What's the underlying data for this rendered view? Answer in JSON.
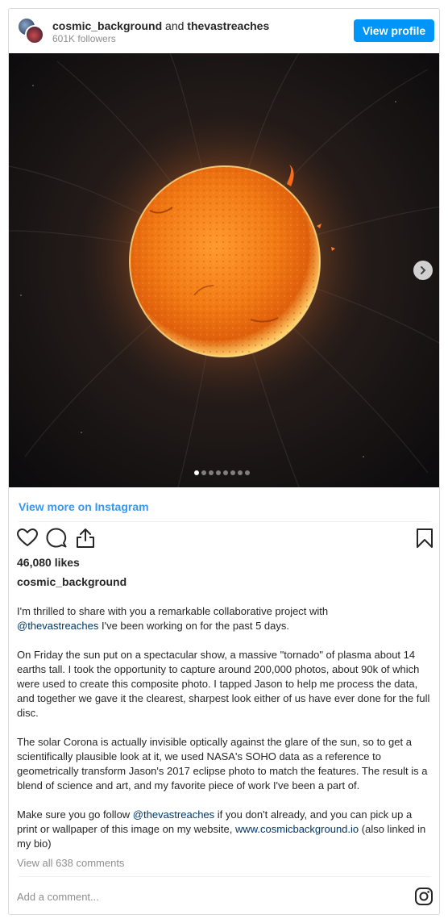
{
  "header": {
    "user1": "cosmic_background",
    "and_text": "and",
    "user2": "thevastreaches",
    "followers": "601K followers",
    "view_profile": "View profile"
  },
  "carousel": {
    "slide_count": 8,
    "active_slide": 1
  },
  "view_more": "View more on Instagram",
  "icons": {
    "like": "heart-icon",
    "comment": "comment-icon",
    "share": "share-icon",
    "save": "bookmark-icon",
    "next": "chevron-right-icon",
    "brand": "instagram-icon"
  },
  "likes": "46,080 likes",
  "owner": "cosmic_background",
  "caption": {
    "p1a": "I'm thrilled to share with you a remarkable collaborative project with",
    "p1_mention": "@thevastreaches",
    "p1b": " I've been working on for the past 5 days.",
    "p2": "On Friday the sun put on a spectacular show, a massive \"tornado\" of plasma about 14 earths tall. I took the opportunity to capture around 200,000 photos, about 90k of which were used to create this composite photo. I tapped Jason to help me process the data, and together we gave it the clearest, sharpest look either of us have ever done for the full disc.",
    "p3": "The solar Corona is actually invisible optically against the glare of the sun, so to get a scientifically plausible look at it, we used NASA's SOHO data as a reference to geometrically transform Jason's 2017 eclipse photo to match the features. The result is a blend of science and art, and my favorite piece of work I've been a part of.",
    "p4a": "Make sure you go follow ",
    "p4_mention": "@thevastreaches",
    "p4b": " if you don't already, and you can pick up a print or wallpaper of this image on my website, ",
    "p4_link": "www.cosmicbackground.io",
    "p4c": " (also linked in my bio)"
  },
  "view_comments": "View all 638 comments",
  "add_comment_placeholder": "Add a comment..."
}
